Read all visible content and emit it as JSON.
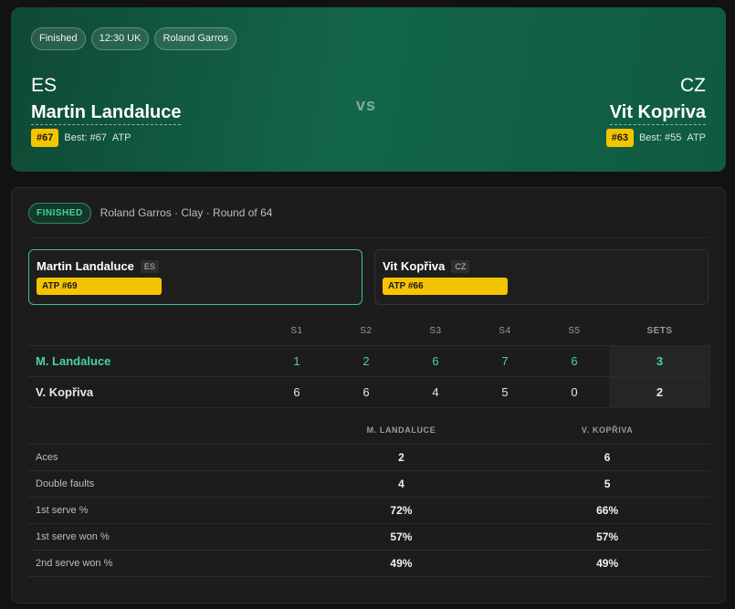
{
  "hero": {
    "pills": [
      "Finished",
      "12:30 UK",
      "Roland Garros"
    ],
    "vs": "vs",
    "left": {
      "country": "ES",
      "name": "Martin Landaluce",
      "rank": "#67",
      "best": "Best: #67",
      "tour": "ATP"
    },
    "right": {
      "country": "CZ",
      "name": "Vit Kopriva",
      "rank": "#63",
      "best": "Best: #55",
      "tour": "ATP"
    }
  },
  "panel": {
    "status": "FINISHED",
    "subtitle": "Roland Garros · Clay · Round of 64",
    "cards": [
      {
        "name": "Martin Landaluce",
        "country": "ES",
        "atp": "ATP #69"
      },
      {
        "name": "Vit Kopřiva",
        "country": "CZ",
        "atp": "ATP #66"
      }
    ]
  },
  "score": {
    "headers": [
      "S1",
      "S2",
      "S3",
      "S4",
      "S5",
      "SETS"
    ],
    "rows": [
      {
        "name": "M. Landaluce",
        "sets": [
          "1",
          "2",
          "6",
          "7",
          "6"
        ],
        "total": "3"
      },
      {
        "name": "V. Kopřiva",
        "sets": [
          "6",
          "6",
          "4",
          "5",
          "0"
        ],
        "total": "2"
      }
    ]
  },
  "stats": {
    "headers": [
      "M. LANDALUCE",
      "V. KOPŘIVA"
    ],
    "rows": [
      {
        "label": "Aces",
        "a": "2",
        "b": "6"
      },
      {
        "label": "Double faults",
        "a": "4",
        "b": "5"
      },
      {
        "label": "1st serve %",
        "a": "72%",
        "b": "66%"
      },
      {
        "label": "1st serve won %",
        "a": "57%",
        "b": "57%"
      },
      {
        "label": "2nd serve won %",
        "a": "49%",
        "b": "49%"
      }
    ]
  },
  "colors": {
    "accent_green": "#4cd39b",
    "rank_yellow": "#f5c400",
    "hero_bg": "#13664a"
  }
}
